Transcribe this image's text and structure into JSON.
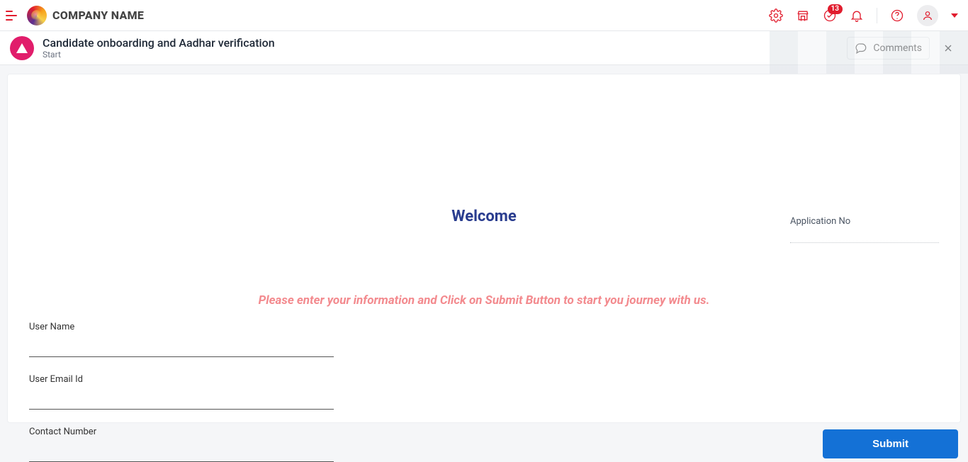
{
  "topnav": {
    "brand_name": "COMPANY NAME",
    "badge_count": "13"
  },
  "subheader": {
    "process_title": "Candidate onboarding and Aadhar verification",
    "process_sub": "Start",
    "comments_label": "Comments"
  },
  "main": {
    "appno_label": "Application No",
    "welcome_heading": "Welcome",
    "instructions": "Please enter your information and Click on Submit Button to start you journey with us.",
    "fields": {
      "user_name_label": "User Name",
      "user_email_label": "User Email Id",
      "contact_number_label": "Contact Number",
      "user_name_value": "",
      "user_email_value": "",
      "contact_number_value": ""
    }
  },
  "footer": {
    "submit_label": "Submit"
  }
}
